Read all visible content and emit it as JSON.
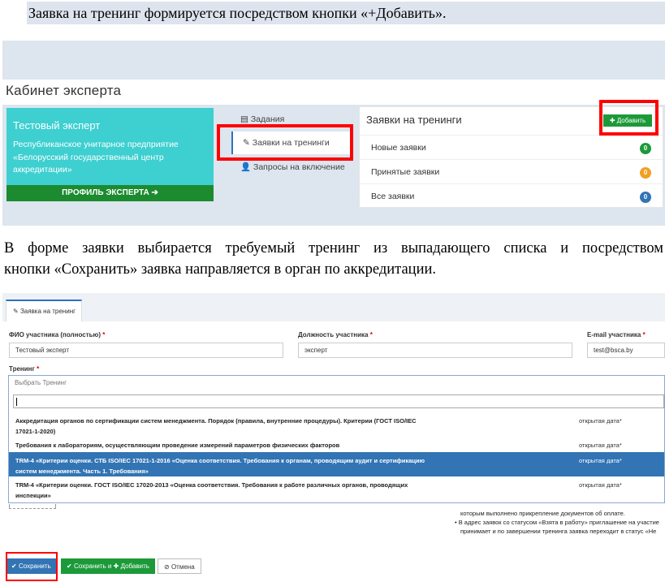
{
  "doc": {
    "para1": "Заявка на тренинг формируется посредством кнопки «+Добавить».",
    "para2_line1": "В форме заявки выбирается требуемый тренинг из выпадающего списка и посредством",
    "para2_line2": "кнопки «Сохранить» заявка направляется в орган по аккредитации."
  },
  "cabinet": {
    "title": "Кабинет эксперта",
    "card": {
      "name": "Тестовый эксперт",
      "org": "Республиканское унитарное предприятие «Белорусский государственный центр аккредитации»",
      "profile_button": "ПРОФИЛЬ ЭКСПЕРТА ➔"
    },
    "menu": [
      {
        "label": "Задания",
        "icon": "tasks-icon"
      },
      {
        "label": "Заявки на тренинги",
        "icon": "pin-icon"
      },
      {
        "label": "Запросы на включение",
        "icon": "user-add-icon"
      }
    ],
    "panel": {
      "title": "Заявки на тренинги",
      "add_button": "Добавить",
      "rows": [
        {
          "label": "Новые заявки",
          "count": "0",
          "color": "#1c9a39"
        },
        {
          "label": "Принятые заявки",
          "count": "0",
          "color": "#f0a020"
        },
        {
          "label": "Все заявки",
          "count": "0",
          "color": "#3274b4"
        }
      ]
    }
  },
  "form": {
    "tab": "Заявка на тренинг",
    "fio_label": "ФИО участника (полностью)",
    "fio_value": "Тестовый эксперт",
    "position_label": "Должность участника",
    "position_value": "эксперт",
    "email_label": "E-mail участника",
    "email_value": "test@bsca.by",
    "training_label": "Тренинг",
    "required_mark": "*",
    "dropdown": {
      "placeholder": "Выбрать Тренинг",
      "options": [
        {
          "line1": "Аккредитация органов по сертификации систем менеджмента. Порядок (правила, внутренние процедуры). Критерии (ГОСТ ISO/IEC",
          "line2": "17021-1-2020)",
          "date": "открытая дата*"
        },
        {
          "line1": "Требования к лабораториям, осуществляющим проведение измерений параметров физических факторов",
          "line2": "",
          "date": "открытая дата*"
        },
        {
          "line1": "TRM-4 «Критерии оценки. СТБ ISO/IEC 17021-1-2016 «Оценка соответствия. Требования к органам, проводящим аудит и сертификацию",
          "line2": "систем менеджмента. Часть 1. Требования»",
          "date": "открытая дата*"
        },
        {
          "line1": "TRM-4 «Критерии оценки. ГОСТ ISO/IEC 17020-2013 «Оценка соответствия. Требования к работе различных органов, проводящих",
          "line2": "инспекции»",
          "date": "открытая дата*"
        }
      ]
    },
    "notes": {
      "line1": "которым выполнено прикрепление документов об оплате.",
      "line2": "В адрес заявок со статусом «Взята в работу» приглашение на участие",
      "line3": "принимает и по завершении тренинга заявка переходит в статус «Не"
    },
    "buttons": {
      "save": "Сохранить",
      "save_add_prefix": "Сохранить и",
      "save_add_suffix": "Добавить",
      "cancel": "Отмена"
    }
  }
}
